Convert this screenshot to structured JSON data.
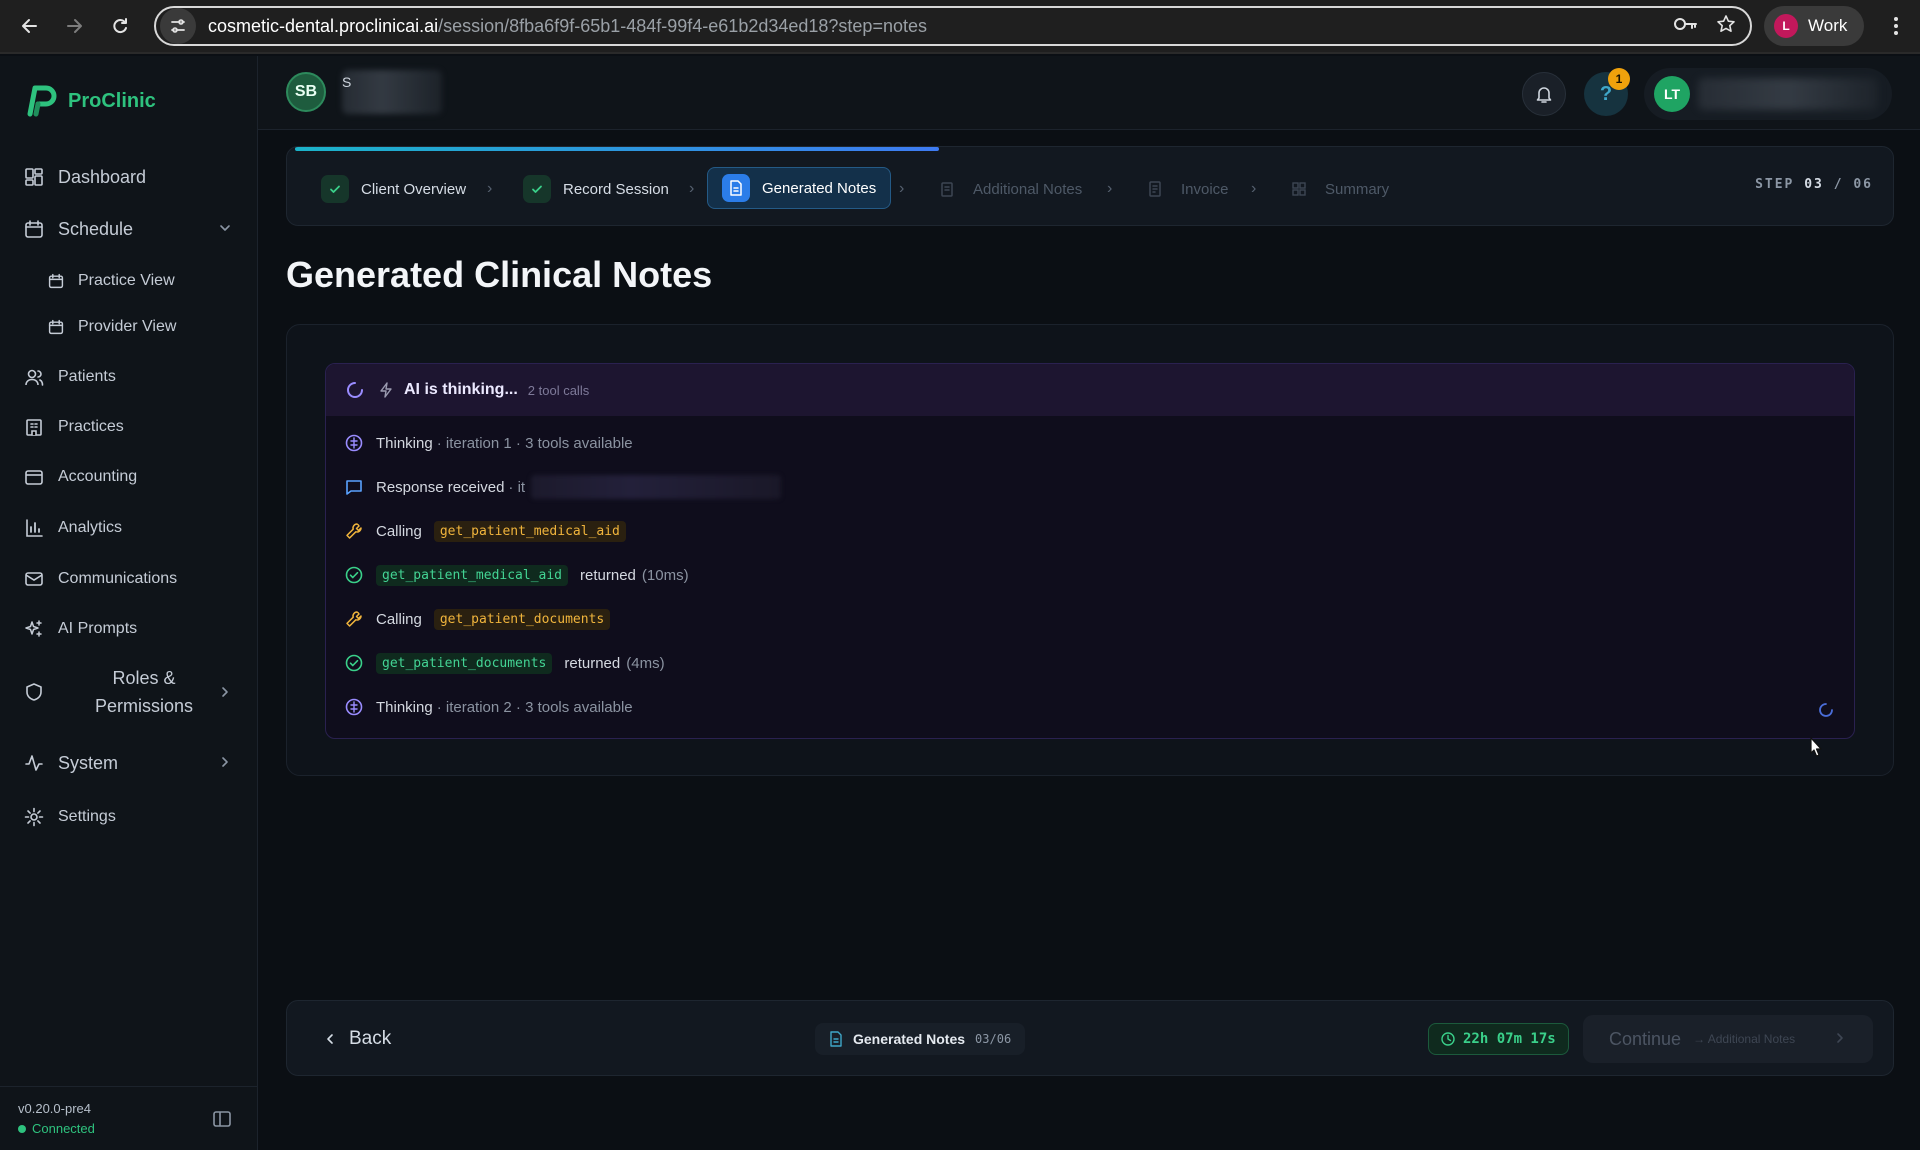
{
  "browser": {
    "url_host": "cosmetic-dental.proclinicai.ai",
    "url_path": "/session/8fba6f9f-65b1-484f-99f4-e61b2d34ed18?step=notes",
    "profile_initial": "L",
    "profile_label": "Work"
  },
  "sidebar": {
    "brand": "ProClinic",
    "items": [
      {
        "label": "Dashboard",
        "icon": "dashboard-icon"
      },
      {
        "label": "Schedule",
        "icon": "calendar-icon"
      },
      {
        "label": "Practice View",
        "icon": "calendar-icon"
      },
      {
        "label": "Provider View",
        "icon": "calendar-icon"
      },
      {
        "label": "Patients",
        "icon": "users-icon"
      },
      {
        "label": "Practices",
        "icon": "building-icon"
      },
      {
        "label": "Accounting",
        "icon": "wallet-icon"
      },
      {
        "label": "Analytics",
        "icon": "bar-chart-icon"
      },
      {
        "label": "Communications",
        "icon": "mail-icon"
      },
      {
        "label": "AI Prompts",
        "icon": "sparkles-icon"
      },
      {
        "label": "Roles & Permissions",
        "icon": "shield-icon"
      },
      {
        "label": "System",
        "icon": "activity-icon"
      },
      {
        "label": "Settings",
        "icon": "gear-icon"
      }
    ],
    "version": "v0.20.0-pre4",
    "status": "Connected"
  },
  "header": {
    "client_initials": "SB",
    "client_name_initial": "S",
    "help_badge": "1",
    "user_initials": "LT"
  },
  "stepper": {
    "steps": [
      {
        "label": "Client Overview",
        "state": "done"
      },
      {
        "label": "Record Session",
        "state": "done"
      },
      {
        "label": "Generated Notes",
        "state": "current"
      },
      {
        "label": "Additional Notes",
        "state": "todo"
      },
      {
        "label": "Invoice",
        "state": "todo"
      },
      {
        "label": "Summary",
        "state": "todo"
      }
    ],
    "step_label": "STEP",
    "step_current": "03",
    "step_total": "/ 06",
    "progress": 0.4
  },
  "main": {
    "title": "Generated Clinical Notes"
  },
  "ai": {
    "status": "AI is thinking...",
    "tool_calls": "2 tool calls",
    "log": [
      {
        "kind": "thinking",
        "text": "Thinking",
        "detail": "· iteration 1 · 3 tools available"
      },
      {
        "kind": "response",
        "text": "Response received",
        "detail": "· it"
      },
      {
        "kind": "calling",
        "text": "Calling",
        "code": "get_patient_medical_aid"
      },
      {
        "kind": "returned",
        "code": "get_patient_medical_aid",
        "text": "returned",
        "detail": "(10ms)"
      },
      {
        "kind": "calling",
        "text": "Calling",
        "code": "get_patient_documents"
      },
      {
        "kind": "returned",
        "code": "get_patient_documents",
        "text": "returned",
        "detail": "(4ms)"
      },
      {
        "kind": "thinking",
        "text": "Thinking",
        "detail": "· iteration 2 · 3 tools available"
      }
    ]
  },
  "footer": {
    "back": "Back",
    "current_step": "Generated Notes",
    "current_step_count": "03/06",
    "timer": "22h 07m 17s",
    "continue": "Continue",
    "continue_next": "→ Additional Notes"
  }
}
